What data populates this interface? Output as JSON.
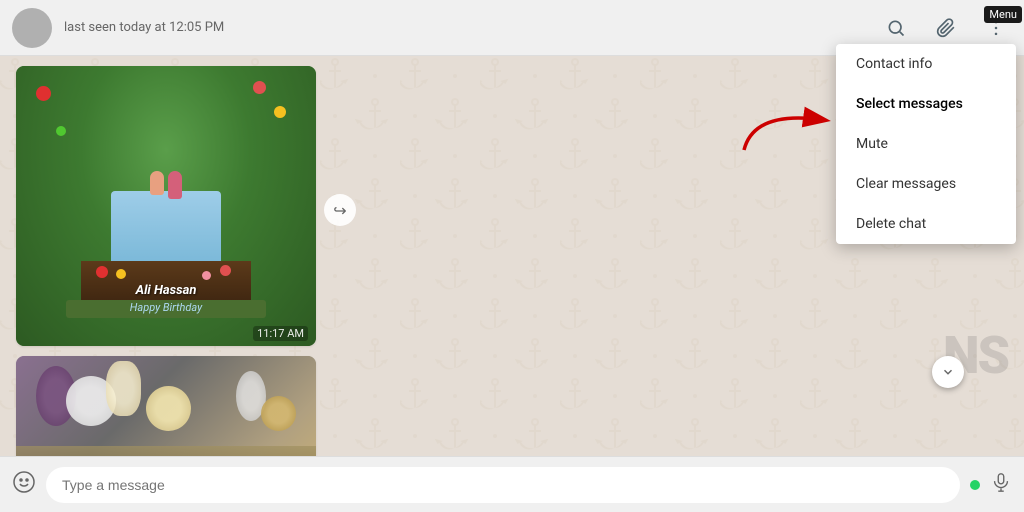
{
  "header": {
    "status": "last seen today at 12:05 PM",
    "menu_label": "Menu"
  },
  "icons": {
    "search": "🔍",
    "attach": "📎",
    "more": "⋮",
    "emoji": "🙂",
    "mic": "🎤",
    "forward": "↪",
    "scroll_down": "⌄"
  },
  "chat": {
    "timestamp": "11:17 AM",
    "cake_text1": "Ali Hassan",
    "cake_text2": "Happy Birthday",
    "watermark": "NS"
  },
  "input": {
    "placeholder": "Type a message"
  },
  "menu": {
    "items": [
      {
        "label": "Contact info",
        "id": "contact-info"
      },
      {
        "label": "Select messages",
        "id": "select-messages"
      },
      {
        "label": "Mute",
        "id": "mute"
      },
      {
        "label": "Clear messages",
        "id": "clear-messages"
      },
      {
        "label": "Delete chat",
        "id": "delete-chat"
      }
    ]
  }
}
